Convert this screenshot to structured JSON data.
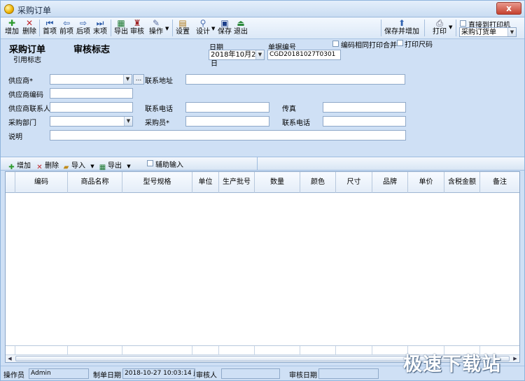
{
  "window": {
    "title": "采购订单",
    "close": "x"
  },
  "toolbar": {
    "add": "增加",
    "delete": "删除",
    "first": "首项",
    "prev": "前项",
    "next": "后项",
    "last": "末项",
    "export": "导出",
    "review": "审核",
    "operate": "操作",
    "settings": "设置",
    "design": "设计",
    "save": "保存",
    "exit": "退出",
    "save_and_add": "保存并增加",
    "print": "打印",
    "direct_print": "直接到打印机",
    "print_template": "采购订货单"
  },
  "header": {
    "doc_title": "采购订单",
    "review_flag": "审核标志",
    "reference_flag": "引用标志",
    "date_label": "日期",
    "date_value": "2018年10月27日",
    "doc_no_label": "单据编号",
    "doc_no_value": "CGD20181027T0301",
    "merge_print": "编码相同打印合并",
    "print_size": "打印尺码",
    "supplier": "供应商*",
    "ellipsis": "...",
    "contact_address": "联系地址",
    "supplier_code": "供应商编码",
    "supplier_contact": "供应商联系人",
    "phone": "联系电话",
    "fax": "传真",
    "dept": "采购部门",
    "buyer": "采购员*",
    "phone2": "联系电话",
    "remark": "说明"
  },
  "detail_toolbar": {
    "add": "增加",
    "delete": "删除",
    "import": "导入",
    "export": "导出",
    "assist": "辅助输入"
  },
  "grid": {
    "columns": [
      "编码",
      "商品名称",
      "型号规格",
      "单位",
      "生产批号",
      "数量",
      "颜色",
      "尺寸",
      "品牌",
      "单价",
      "含税金额",
      "备注"
    ]
  },
  "status": {
    "operator_label": "操作员",
    "operator_value": "Admin",
    "date_label": "制单日期",
    "date_value": "2018-10-27 10:03:14 ji",
    "reviewer_label": "审核人",
    "review_date_label": "审核日期"
  },
  "watermark": "极速下载站"
}
